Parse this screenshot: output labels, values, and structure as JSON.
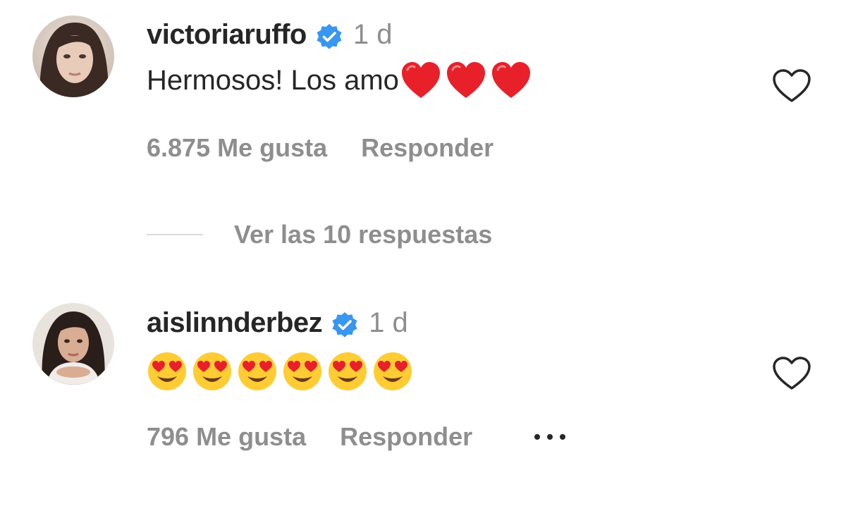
{
  "comments": [
    {
      "username": "victoriaruffo",
      "verified": true,
      "time": "1 d",
      "text": "Hermosos! Los amo",
      "emojis": [
        "red-heart",
        "red-heart",
        "red-heart"
      ],
      "likes": "6.875 Me gusta",
      "reply_label": "Responder",
      "view_replies": "Ver las 10 respuestas"
    },
    {
      "username": "aislinnderbez",
      "verified": true,
      "time": "1 d",
      "text": "",
      "emojis": [
        "heart-eyes",
        "heart-eyes",
        "heart-eyes",
        "heart-eyes",
        "heart-eyes",
        "heart-eyes"
      ],
      "likes": "796 Me gusta",
      "reply_label": "Responder",
      "more_icon": "ellipsis-icon"
    }
  ],
  "colors": {
    "primary_text": "#262626",
    "secondary_text": "#8e8e8e",
    "verified_blue": "#3897f0",
    "divider": "#dbdbdb"
  }
}
